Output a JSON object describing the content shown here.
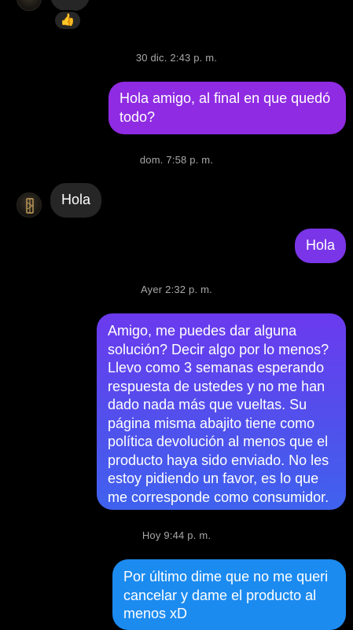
{
  "colors": {
    "background": "#000000",
    "incoming_bubble": "#262626",
    "timestamp_text": "#a8a8a8",
    "outgoing_purple": "#8e2de2",
    "outgoing_violet": "#6a3ef0",
    "outgoing_blue": "#1d8cf0"
  },
  "icons": {
    "reaction": "thumbs-up-emoji",
    "avatar": "profile-logo"
  },
  "conversation": {
    "reaction_emoji": "👍",
    "messages": [
      {
        "timestamp": "30 dic. 2:43 p. m."
      },
      {
        "sender": "me",
        "text": "Hola amigo, al final en que quedó todo?"
      },
      {
        "timestamp": "dom. 7:58 p. m."
      },
      {
        "sender": "them",
        "text": "Hola"
      },
      {
        "sender": "me",
        "text": "Hola"
      },
      {
        "timestamp": "Ayer 2:32 p. m."
      },
      {
        "sender": "me",
        "text": "Amigo, me puedes dar alguna solución? Decir algo por lo menos? Llevo como 3 semanas esperando respuesta de ustedes y no me han dado nada más que vueltas. Su página misma abajito tiene como política devolución al menos que el producto haya sido enviado. No les estoy pidiendo un favor, es lo que me corresponde como consumidor."
      },
      {
        "timestamp": "Hoy 9:44 p. m."
      },
      {
        "sender": "me",
        "text": "Por último dime que no me queri cancelar y dame el producto al menos xD"
      }
    ]
  }
}
